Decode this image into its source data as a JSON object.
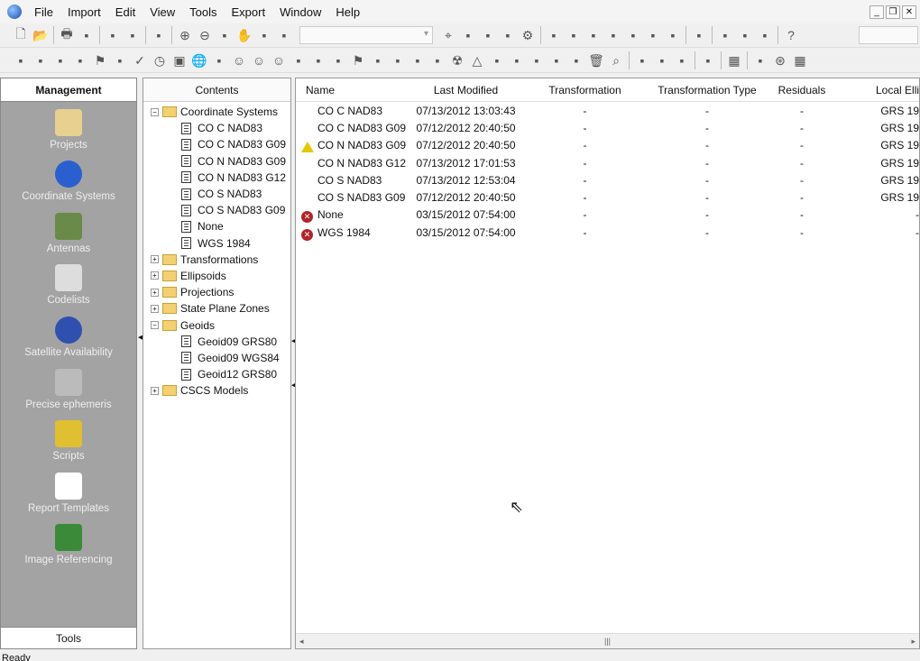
{
  "menu": [
    "File",
    "Import",
    "Edit",
    "View",
    "Tools",
    "Export",
    "Window",
    "Help"
  ],
  "toolbar1": [
    "new-icon",
    "open-icon",
    "|",
    "print-icon",
    "print-preview-icon",
    "|",
    "copy-icon",
    "paste-icon",
    "|",
    "import-icon",
    "|",
    "zoom-in-icon",
    "zoom-out-icon",
    "zoom-extents-icon",
    "pan-icon",
    "layers-icon",
    "3d-icon",
    "combo",
    "target-icon",
    "scissors-icon",
    "chart-icon",
    "tool-icon",
    "gear-icon",
    "|",
    "line-icon",
    "hammer-icon",
    "hammer2-icon",
    "triangle-icon",
    "shape-icon",
    "globe-settings-icon",
    "toggle-icon",
    "|",
    "arrow-icon",
    "|",
    "binoculars-icon",
    "binoculars-green-icon",
    "binoculars-yellow-icon",
    "|",
    "help-icon"
  ],
  "toolbar2": [
    "map-icon",
    "bar-icon",
    "bar2-icon",
    "target-circle-icon",
    "flag-icon",
    "plane-icon",
    "check-icon",
    "clock-icon",
    "save-icon",
    "earth-icon",
    "pen-icon",
    "smiley-icon",
    "smiley2-icon",
    "smiley3-icon",
    "printer-icon",
    "flag-small-icon",
    "ruler-icon",
    "red-flag-icon",
    "histogram-icon",
    "satellite-icon",
    "bulb-icon",
    "pencil-icon",
    "radiation-icon",
    "bell-icon",
    "arrow2-icon",
    "bracket-icon",
    "camera-icon",
    "hand-icon",
    "bottle-icon",
    "trash-icon",
    "search-icon",
    "|",
    "next-icon",
    "next2-icon",
    "sort-icon",
    "|",
    "print2-icon",
    "|",
    "grid-icon",
    "|",
    "axis-icon",
    "globe2-icon",
    "table-icon"
  ],
  "sidebar": {
    "title": "Management",
    "items": [
      "Projects",
      "Coordinate Systems",
      "Antennas",
      "Codelists",
      "Satellite Availability",
      "Precise ephemeris",
      "Scripts",
      "Report Templates",
      "Image Referencing"
    ],
    "footer": "Tools"
  },
  "tree": {
    "title": "Contents",
    "nodes": [
      {
        "label": "Coordinate Systems",
        "type": "folder",
        "expanded": true,
        "level": 0
      },
      {
        "label": "CO C NAD83",
        "type": "doc",
        "level": 1
      },
      {
        "label": "CO C NAD83 G09",
        "type": "doc",
        "level": 1
      },
      {
        "label": "CO N NAD83 G09",
        "type": "doc",
        "level": 1
      },
      {
        "label": "CO N NAD83 G12",
        "type": "doc",
        "level": 1
      },
      {
        "label": "CO S NAD83",
        "type": "doc",
        "level": 1
      },
      {
        "label": "CO S NAD83 G09",
        "type": "doc",
        "level": 1
      },
      {
        "label": "None",
        "type": "doc",
        "level": 1
      },
      {
        "label": "WGS 1984",
        "type": "doc",
        "level": 1
      },
      {
        "label": "Transformations",
        "type": "folder",
        "expanded": false,
        "level": 0
      },
      {
        "label": "Ellipsoids",
        "type": "folder",
        "expanded": false,
        "level": 0
      },
      {
        "label": "Projections",
        "type": "folder",
        "expanded": false,
        "level": 0
      },
      {
        "label": "State Plane Zones",
        "type": "folder",
        "expanded": false,
        "level": 0
      },
      {
        "label": "Geoids",
        "type": "folder",
        "expanded": true,
        "level": 0
      },
      {
        "label": "Geoid09 GRS80",
        "type": "doc",
        "level": 1
      },
      {
        "label": "Geoid09 WGS84",
        "type": "doc",
        "level": 1
      },
      {
        "label": "Geoid12 GRS80",
        "type": "doc",
        "level": 1
      },
      {
        "label": "CSCS Models",
        "type": "folder",
        "expanded": false,
        "level": 0
      }
    ]
  },
  "list": {
    "columns": [
      "Name",
      "Last Modified",
      "Transformation",
      "Transformation Type",
      "Residuals",
      "Local Elli"
    ],
    "rows": [
      {
        "status": "",
        "cells": [
          "CO C NAD83",
          "07/13/2012 13:03:43",
          "-",
          "-",
          "-",
          "GRS 19"
        ]
      },
      {
        "status": "",
        "cells": [
          "CO C NAD83 G09",
          "07/12/2012 20:40:50",
          "-",
          "-",
          "-",
          "GRS 19"
        ]
      },
      {
        "status": "warning",
        "cells": [
          "CO N NAD83 G09",
          "07/12/2012 20:40:50",
          "-",
          "-",
          "-",
          "GRS 19"
        ]
      },
      {
        "status": "",
        "cells": [
          "CO N NAD83 G12",
          "07/13/2012 17:01:53",
          "-",
          "-",
          "-",
          "GRS 19"
        ]
      },
      {
        "status": "",
        "cells": [
          "CO S NAD83",
          "07/13/2012 12:53:04",
          "-",
          "-",
          "-",
          "GRS 19"
        ]
      },
      {
        "status": "",
        "cells": [
          "CO S NAD83 G09",
          "07/12/2012 20:40:50",
          "-",
          "-",
          "-",
          "GRS 19"
        ]
      },
      {
        "status": "error",
        "cells": [
          "None",
          "03/15/2012 07:54:00",
          "-",
          "-",
          "-",
          "-"
        ]
      },
      {
        "status": "error",
        "cells": [
          "WGS 1984",
          "03/15/2012 07:54:00",
          "-",
          "-",
          "-",
          "-"
        ]
      }
    ]
  },
  "status": "Ready",
  "colors": {
    "sidebar": "#a3a3a3",
    "warning": "#e3c800",
    "error": "#b0242a"
  }
}
